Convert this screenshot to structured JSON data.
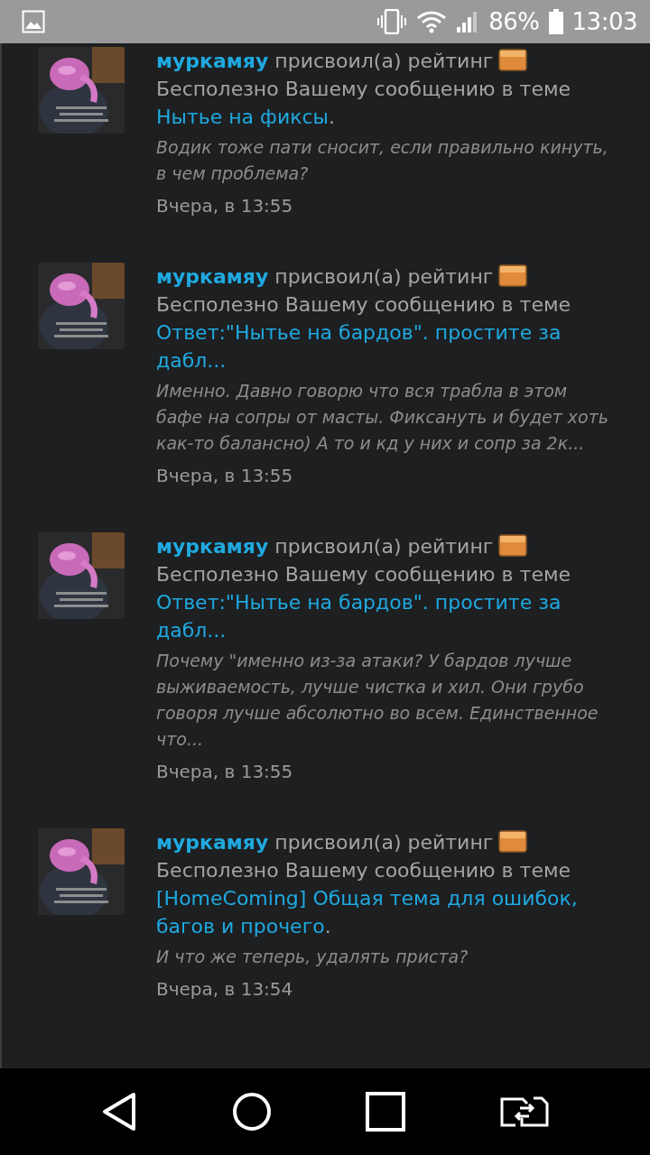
{
  "status_bar": {
    "battery": "86%",
    "time": "13:03"
  },
  "notifications": [
    {
      "user": "муркамяу",
      "action": "присвоил(а) рейтинг",
      "rating": "Бесполезно",
      "message": "Вашему сообщению в теме",
      "topic": "Нытье на фиксы",
      "suffix": ".",
      "quote": "Водик тоже пати сносит, если правильно кинуть, в чем проблема?",
      "date": "Вчера, в 13:55"
    },
    {
      "user": "муркамяу",
      "action": "присвоил(а) рейтинг",
      "rating": "Бесполезно",
      "message": "Вашему сообщению в теме",
      "topic": "Ответ:\"Нытье на бардов\". простите за дабл...",
      "quote": "Именно. Давно говорю что вся трабла в этом бафе на сопры от масты. Фиксануть и будет хоть как-то балансно) А то и кд у них и сопр за 2к...",
      "date": "Вчера, в 13:55"
    },
    {
      "user": "муркамяу",
      "action": "присвоил(а) рейтинг",
      "rating": "Бесполезно",
      "message": "Вашему сообщению в теме",
      "topic": "Ответ:\"Нытье на бардов\". простите за дабл...",
      "quote": "Почему \"именно из-за атаки? У бардов лучше выживаемость, лучше чистка и хил. Они грубо говоря лучше абсолютно во всем. Единственное что...",
      "date": "Вчера, в 13:55"
    },
    {
      "user": "муркамяу",
      "action": "присвоил(а) рейтинг",
      "rating": "Бесполезно",
      "message": "Вашему сообщению в теме",
      "topic": "[HomeComing] Общая тема для ошибок, багов и прочего",
      "suffix": ".",
      "quote": "И что же теперь, удалять приста?",
      "date": "Вчера, в 13:54"
    }
  ]
}
